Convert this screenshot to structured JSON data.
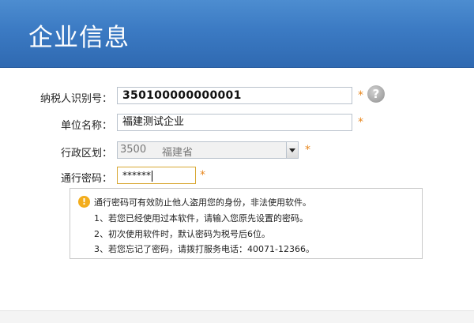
{
  "header": {
    "title": "企业信息"
  },
  "form": {
    "tax_id": {
      "label": "纳税人识别号：",
      "value": "350100000000001",
      "required_mark": "*"
    },
    "unit_name": {
      "label": "单位名称：",
      "value": "福建测试企业",
      "required_mark": "*"
    },
    "region": {
      "label": "行政区划：",
      "code": "3500",
      "province": "福建省",
      "required_mark": "*"
    },
    "password": {
      "label": "通行密码：",
      "value": "******",
      "required_mark": "*"
    },
    "help": {
      "glyph": "?"
    }
  },
  "notice": {
    "icon_glyph": "!",
    "lines": [
      "通行密码可有效防止他人盗用您的身份，非法使用软件。",
      "1、若您已经使用过本软件，请输入您原先设置的密码。",
      "2、初次使用软件时，默认密码为税号后6位。",
      "3、若您忘记了密码，请拨打服务电话：40071-12366。"
    ]
  },
  "colors": {
    "header_blue": "#3b7ac3",
    "required_star": "#e8871e",
    "warning_icon": "#f3ad1c"
  },
  "icons": {
    "help": "help-question-icon",
    "warning": "warning-icon",
    "dropdown": "chevron-down-icon"
  }
}
